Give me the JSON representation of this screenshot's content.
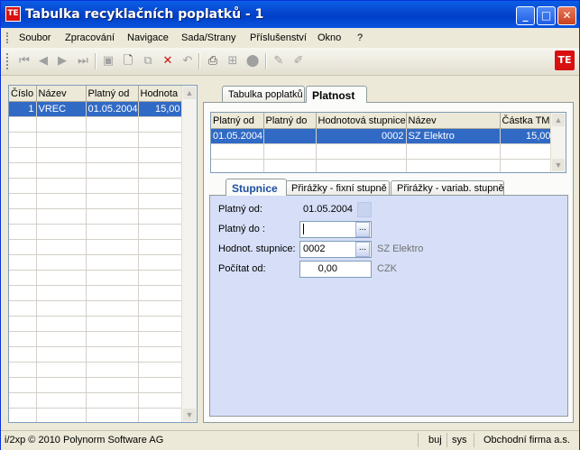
{
  "window": {
    "title": "Tabulka  recyklačních poplatků - 1",
    "icon_text": "TE",
    "minimize_glyph": "_",
    "maximize_glyph": "□",
    "close_glyph": "✕"
  },
  "menu": [
    "Soubor",
    "Zpracování",
    "Navigace",
    "Sada/Strany",
    "Příslušenství",
    "Okno",
    "?"
  ],
  "toolbar": {
    "icons": [
      "first-record-icon",
      "prev-record-icon",
      "next-record-icon",
      "last-record-icon",
      "save-icon",
      "new-icon",
      "copy-icon",
      "delete-icon",
      "undo-icon",
      "print-icon",
      "tree-icon",
      "stop-icon",
      "edit-icon",
      "edit-alt-icon"
    ],
    "brand_text": "TE"
  },
  "left_grid": {
    "columns": [
      "Číslo",
      "Název",
      "Platný od",
      "Hodnota"
    ],
    "rows": [
      {
        "cislo": "1",
        "nazev": "VREC",
        "platny_od": "01.05.2004",
        "hodnota": "15,00"
      }
    ],
    "scroll_up": "▲",
    "scroll_down": "▼"
  },
  "tabs": [
    {
      "label": "Tabulka poplatků",
      "active": false
    },
    {
      "label": "Platnost",
      "active": true
    }
  ],
  "platnost_grid": {
    "columns": [
      "Platný od",
      "Platný do",
      "Hodnotová stupnice",
      "Název",
      "Částka TM"
    ],
    "rows": [
      {
        "platny_od": "01.05.2004",
        "platny_do": "",
        "stupnice": "0002",
        "nazev": "SZ Elektro",
        "castka": "15,00"
      }
    ],
    "scroll_up": "▲",
    "scroll_down": "▼"
  },
  "subtabs": [
    {
      "label": "Stupnice",
      "active": true
    },
    {
      "label": "Přirážky - fixní stupně",
      "active": false
    },
    {
      "label": "Přirážky - variab. stupně",
      "active": false
    }
  ],
  "form": {
    "platny_od_label": "Platný od:",
    "platny_od_value": "01.05.2004",
    "platny_do_label": "Platný do :",
    "platny_do_value": "",
    "stupnice_label": "Hodnot. stupnice:",
    "stupnice_value": "0002",
    "stupnice_name": "SZ Elektro",
    "pocitat_label": "Počítat od:",
    "pocitat_value": "0,00",
    "currency": "CZK",
    "picker_glyph": "..."
  },
  "status": {
    "copyright": "i/2xp © 2010 Polynorm Software AG",
    "user": "buj",
    "system": "sys",
    "company": "Obchodní firma a.s."
  },
  "colors": {
    "selection": "#316ac5",
    "brand_red": "#d81010",
    "titlebar": "#0848d0"
  }
}
